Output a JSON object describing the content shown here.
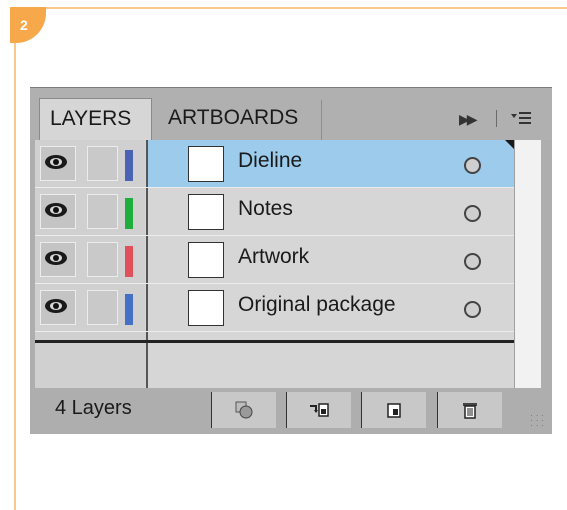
{
  "step": {
    "number": "2"
  },
  "panel": {
    "tabs": [
      {
        "label": "LAYERS"
      },
      {
        "label": "ARTBOARDS"
      }
    ],
    "menu": {
      "forward_icon": "fast-forward-icon",
      "menu_icon": "panel-menu-icon"
    },
    "layers": [
      {
        "name": "Dieline",
        "color": "#4a63b5",
        "selected": true
      },
      {
        "name": "Notes",
        "color": "#1fae3c",
        "selected": false
      },
      {
        "name": "Artwork",
        "color": "#e0505a",
        "selected": false
      },
      {
        "name": "Original package",
        "color": "#4470c8",
        "selected": false
      }
    ],
    "footer": {
      "count": "4 Layers",
      "buttons": [
        {
          "icon": "make-clipping-mask-icon"
        },
        {
          "icon": "create-sublayer-icon"
        },
        {
          "icon": "create-new-layer-icon"
        },
        {
          "icon": "trash-icon"
        }
      ]
    }
  },
  "colors": {
    "frame_accent": "#f6a84a",
    "selection": "#9ccbec"
  }
}
